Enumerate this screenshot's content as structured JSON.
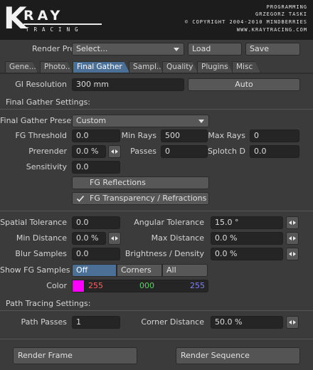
{
  "header": {
    "logo_k": "K",
    "logo_ray": "RAY",
    "logo_sub": "TRACING",
    "credits": [
      "PROGRAMMING",
      "GRZEGORZ TASKI",
      "© COPYRIGHT 2004-2010 MINDBERRIES",
      "WWW.KRAYTRACING.COM"
    ]
  },
  "preset": {
    "label": "Render Preset",
    "value": "Select...",
    "load": "Load",
    "save": "Save"
  },
  "tabs": [
    "Gene...",
    "Photo...",
    "Final Gather",
    "Sampl...",
    "Quality",
    "Plugins",
    "Misc"
  ],
  "active_tab": "Final Gather",
  "gi": {
    "label": "GI Resolution",
    "value": "300 mm",
    "auto": "Auto"
  },
  "fg_section": "Final Gather Settings:",
  "fg_preset": {
    "label": "Final Gather Preset",
    "value": "Custom"
  },
  "fg_threshold": {
    "label": "FG Threshold",
    "value": "0.0"
  },
  "min_rays": {
    "label": "Min Rays",
    "value": "500"
  },
  "max_rays": {
    "label": "Max Rays",
    "value": "0"
  },
  "prerender": {
    "label": "Prerender",
    "value": "0.0 %"
  },
  "passes": {
    "label": "Passes",
    "value": "0"
  },
  "splotch": {
    "label": "Splotch D",
    "value": "0.0"
  },
  "sensitivity": {
    "label": "Sensitivity",
    "value": "0.0"
  },
  "fg_reflections": {
    "label": "FG Reflections",
    "checked": false
  },
  "fg_transparency": {
    "label": "FG Transparency / Refractions",
    "checked": true
  },
  "spatial_tol": {
    "label": "Spatial Tolerance",
    "value": "0.0"
  },
  "angular_tol": {
    "label": "Angular Tolerance",
    "value": "15.0 °"
  },
  "min_distance": {
    "label": "Min Distance",
    "value": "0.0 %"
  },
  "max_distance": {
    "label": "Max Distance",
    "value": "0.0 %"
  },
  "blur_samples": {
    "label": "Blur Samples",
    "value": "0.0"
  },
  "brightness": {
    "label": "Brightness / Density",
    "value": "0.0 %"
  },
  "show_fg": {
    "label": "Show FG Samples",
    "options": [
      "Off",
      "Corners",
      "All"
    ],
    "selected": "Off"
  },
  "color": {
    "label": "Color",
    "swatch": "#ff00ff",
    "r": "255",
    "g": "000",
    "b": "255",
    "r_color": "#ff6060",
    "g_color": "#60d060",
    "b_color": "#8080ff"
  },
  "path_section": "Path Tracing Settings:",
  "path_passes": {
    "label": "Path Passes",
    "value": "1"
  },
  "corner_distance": {
    "label": "Corner Distance",
    "value": "50.0 %"
  },
  "render_frame": "Render Frame",
  "render_sequence": "Render Sequence"
}
